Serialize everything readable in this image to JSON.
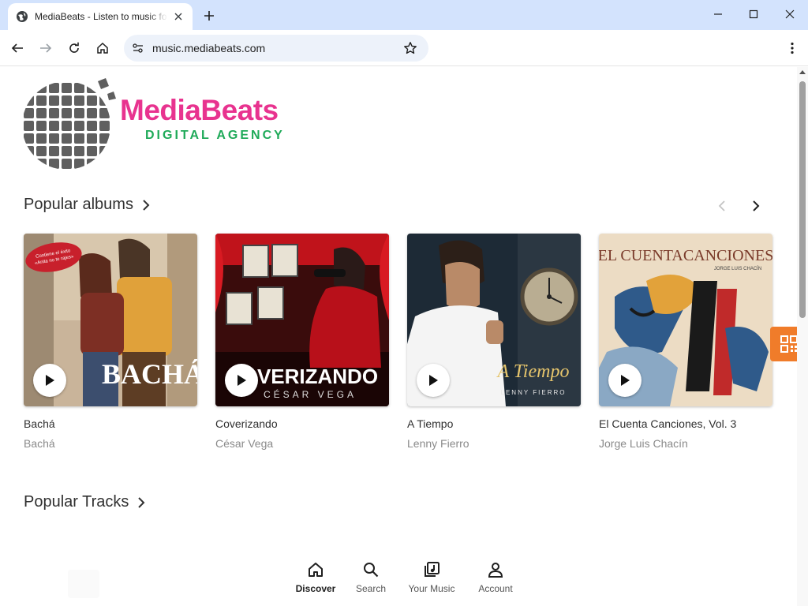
{
  "browser": {
    "tab_title": "MediaBeats - Listen to music for free",
    "url": "music.mediabeats.com"
  },
  "brand": {
    "name": "MediaBeats",
    "tagline": "DIGITAL AGENCY",
    "name_color": "#e8338f",
    "tagline_color": "#1faa59"
  },
  "sections": {
    "popular_albums": "Popular albums",
    "popular_tracks": "Popular Tracks"
  },
  "albums": [
    {
      "title": "Bachá",
      "artist": "Bachá",
      "cover_text": "BACHÁ",
      "sticker_text": "Contiene el éxito de la telenovela «Anita no te rajes»"
    },
    {
      "title": "Coverizando",
      "artist": "César Vega",
      "cover_text": "COVERIZANDO",
      "cover_subtext": "CÉSAR VEGA"
    },
    {
      "title": "A Tiempo",
      "artist": "Lenny Fierro",
      "cover_text": "A Tiempo",
      "cover_subtext": "LENNY FIERRO"
    },
    {
      "title": "El Cuenta Canciones, Vol. 3",
      "artist": "Jorge Luis Chacín",
      "cover_text": "EL CUENTACANCIONES",
      "cover_subtext": "JORGE LUIS CHACÍN"
    }
  ],
  "bottom_nav": [
    {
      "label": "Discover",
      "icon": "home-icon",
      "active": true
    },
    {
      "label": "Search",
      "icon": "search-icon"
    },
    {
      "label": "Your Music",
      "icon": "music-library-icon"
    },
    {
      "label": "Account",
      "icon": "account-icon"
    }
  ],
  "accent_color": "#f07c2a"
}
